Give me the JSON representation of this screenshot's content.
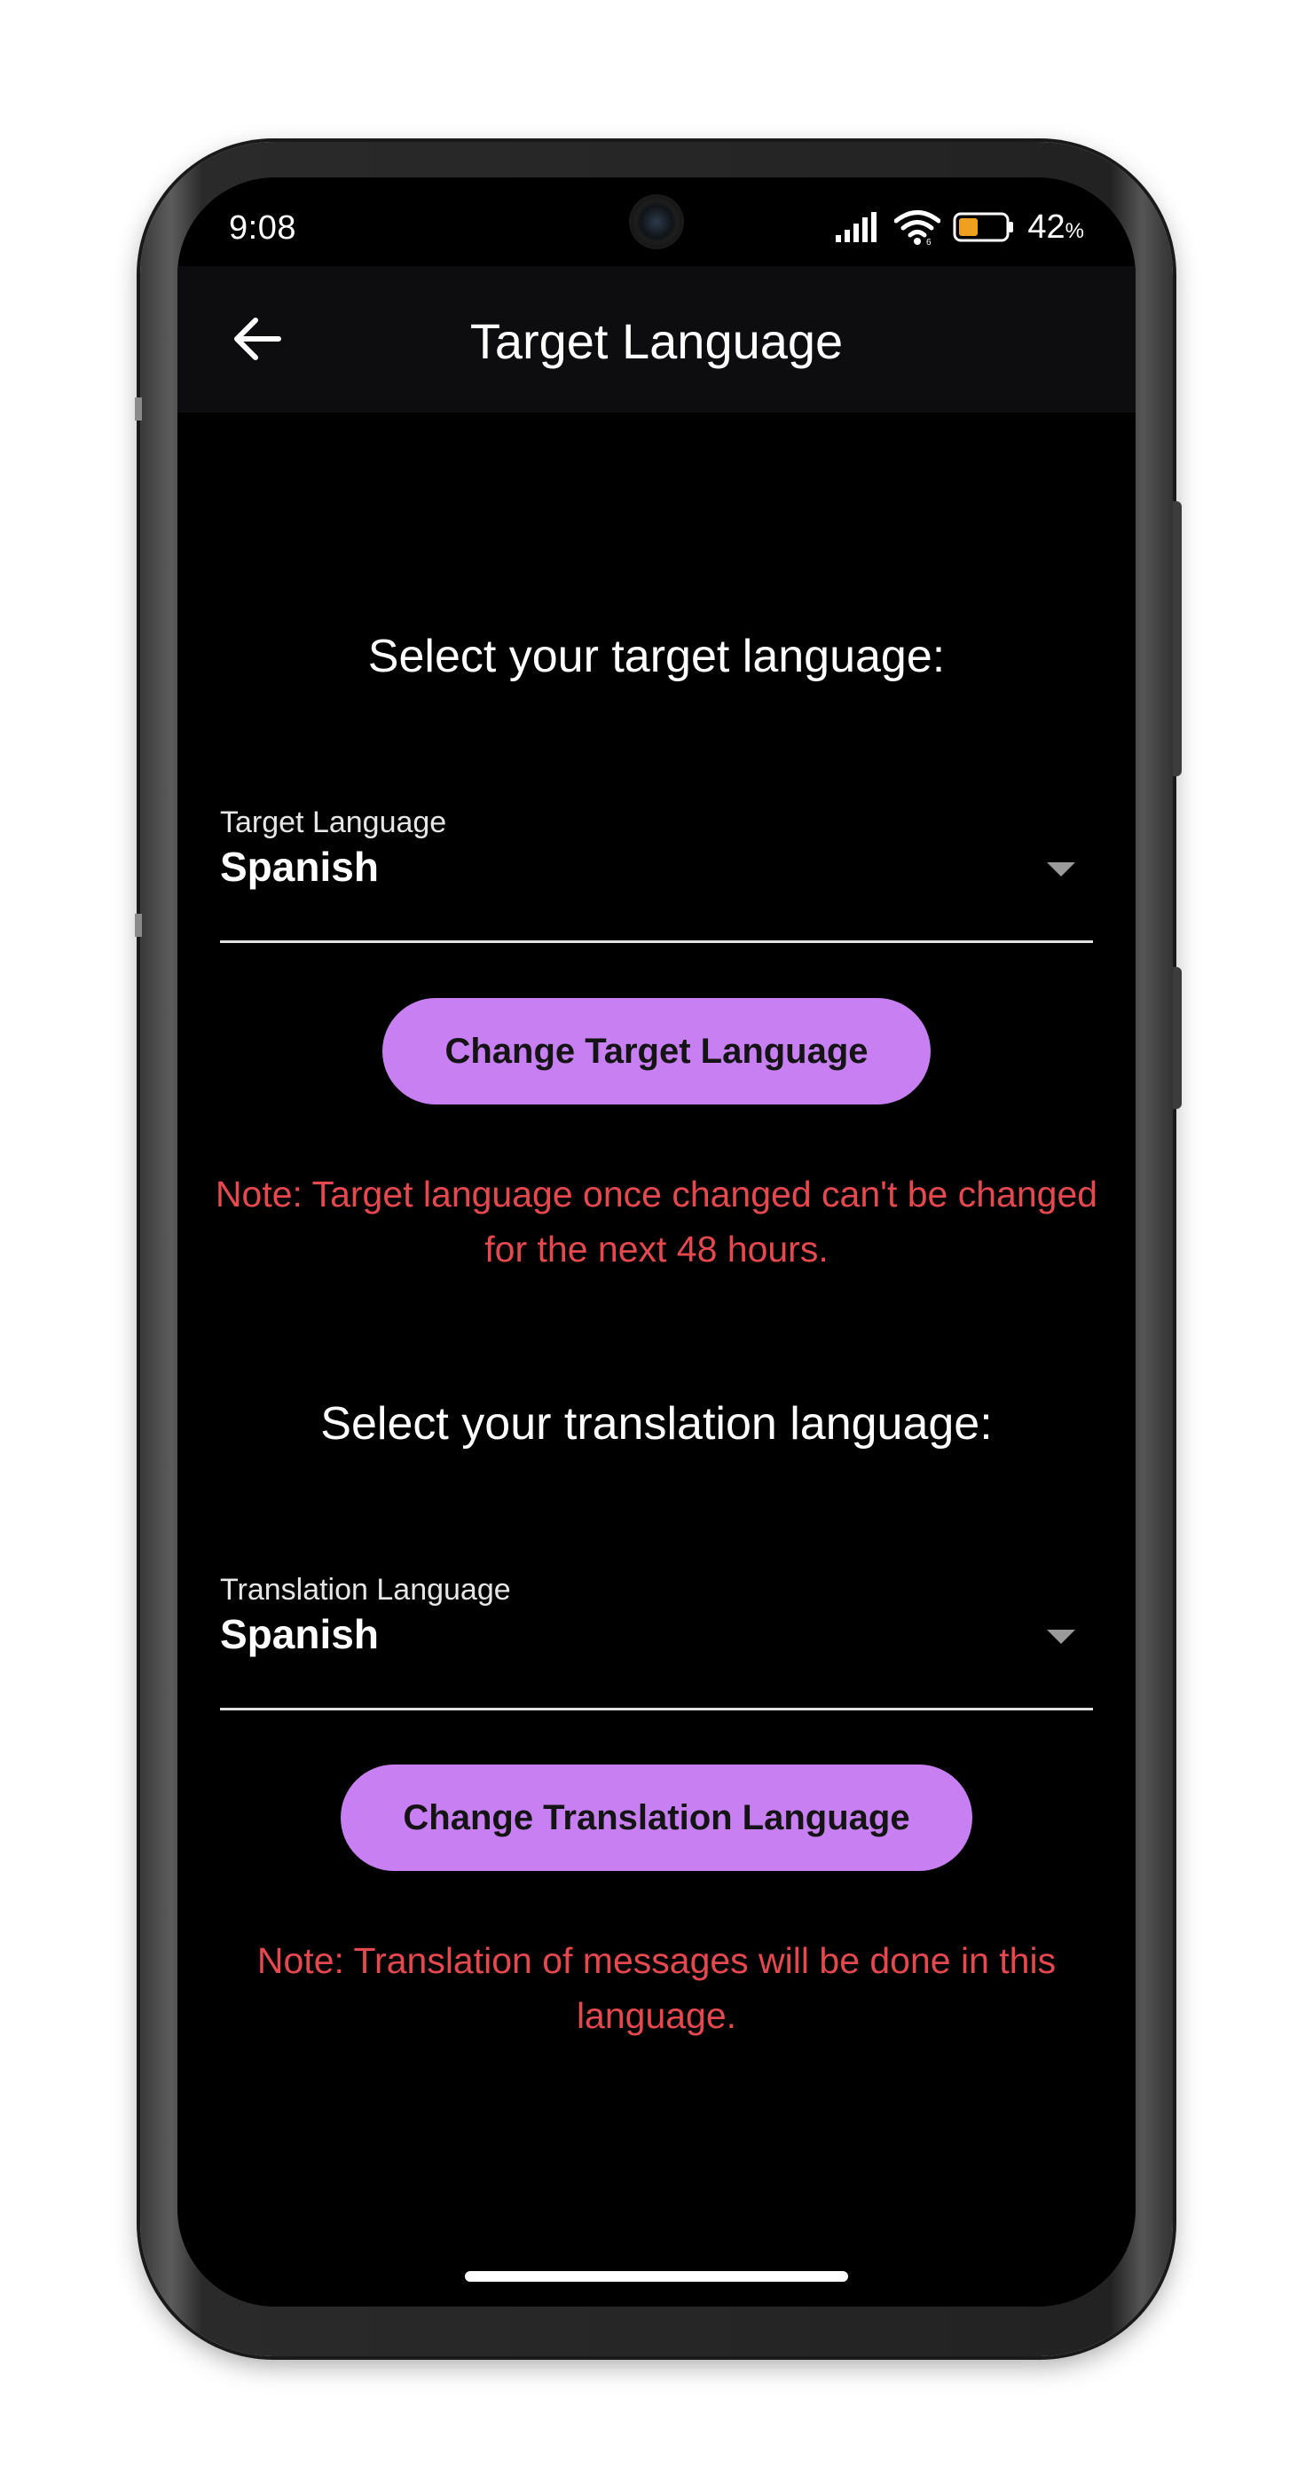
{
  "status_bar": {
    "time": "9:08",
    "battery_percent": "42",
    "battery_unit": "%",
    "battery_level": 0.42,
    "battery_color": "#f0a020"
  },
  "app_bar": {
    "title": "Target Language",
    "back_icon": "arrow-left-icon"
  },
  "target_section": {
    "heading": "Select your target language:",
    "dropdown": {
      "label": "Target Language",
      "value": "Spanish"
    },
    "button_label": "Change Target Language",
    "note": "Note: Target language once changed can't be changed for the next 48 hours."
  },
  "translation_section": {
    "heading": "Select your translation language:",
    "dropdown": {
      "label": "Translation Language",
      "value": "Spanish"
    },
    "button_label": "Change Translation Language",
    "note": "Note: Translation of messages will be done in this language."
  },
  "colors": {
    "accent": "#c77ff2",
    "note": "#e5484d",
    "background": "#000000",
    "app_bar": "#0d0d10"
  }
}
